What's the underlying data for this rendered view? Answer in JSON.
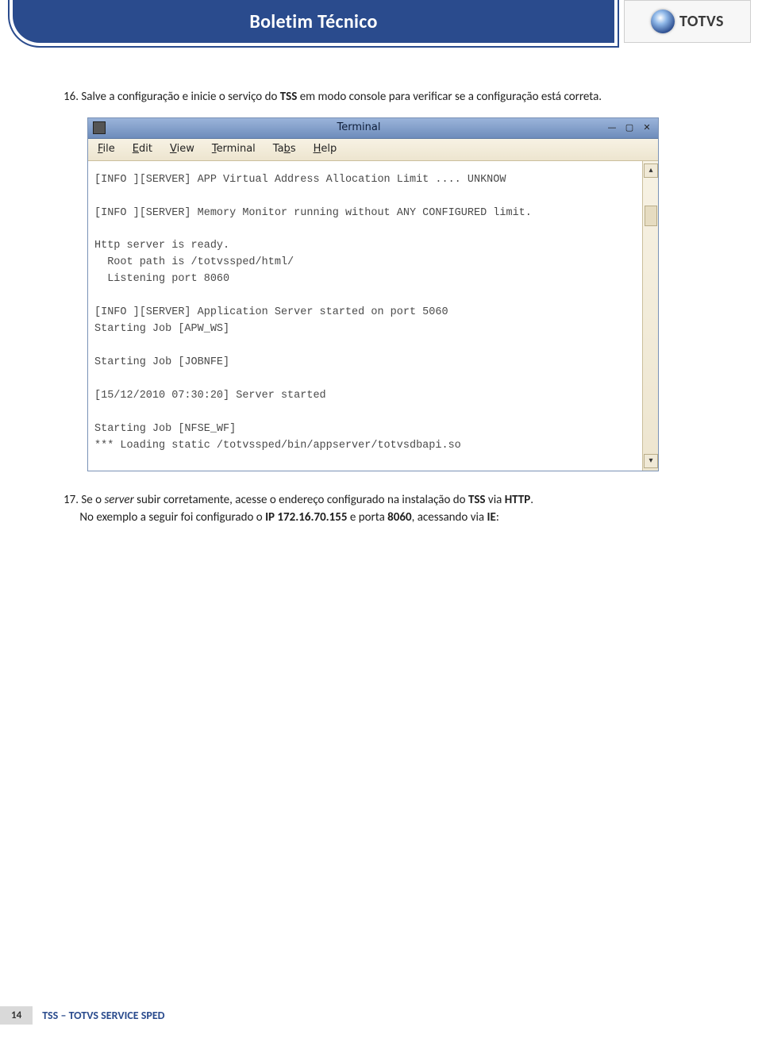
{
  "header": {
    "title": "Boletim Técnico",
    "logo_text": "TOTVS"
  },
  "body": {
    "item16_num": "16.",
    "item16_text_a": "Salve a configuração e inicie o serviço do ",
    "item16_bold_tss": "TSS",
    "item16_text_b": " em modo console para verificar se a configuração está correta.",
    "item17_num": "17.",
    "item17_text_a": "Se o ",
    "item17_italic_server": "server",
    "item17_text_b": " subir corretamente, acesse o endereço configurado na instalação do ",
    "item17_bold_tss": "TSS",
    "item17_text_c": " via ",
    "item17_bold_http": "HTTP",
    "item17_text_d": ".",
    "item17_line2_a": "No exemplo a seguir foi configurado o ",
    "item17_bold_ip": "IP 172.16.70.155",
    "item17_line2_b": " e porta ",
    "item17_bold_port": "8060",
    "item17_line2_c": ", acessando via ",
    "item17_bold_ie": "IE",
    "item17_line2_d": ":"
  },
  "terminal": {
    "title": "Terminal",
    "menu": {
      "file": "File",
      "edit": "Edit",
      "view": "View",
      "terminal": "Terminal",
      "tabs": "Tabs",
      "help": "Help"
    },
    "lines": "[INFO ][SERVER] APP Virtual Address Allocation Limit .... UNKNOW\n\n[INFO ][SERVER] Memory Monitor running without ANY CONFIGURED limit.\n\nHttp server is ready.\n  Root path is /totvssped/html/\n  Listening port 8060\n\n[INFO ][SERVER] Application Server started on port 5060\nStarting Job [APW_WS]\n\nStarting Job [JOBNFE]\n\n[15/12/2010 07:30:20] Server started\n\nStarting Job [NFSE_WF]\n*** Loading static /totvssped/bin/appserver/totvsdbapi.so"
  },
  "footer": {
    "page_number": "14",
    "title": "TSS – TOTVS SERVICE SPED"
  }
}
